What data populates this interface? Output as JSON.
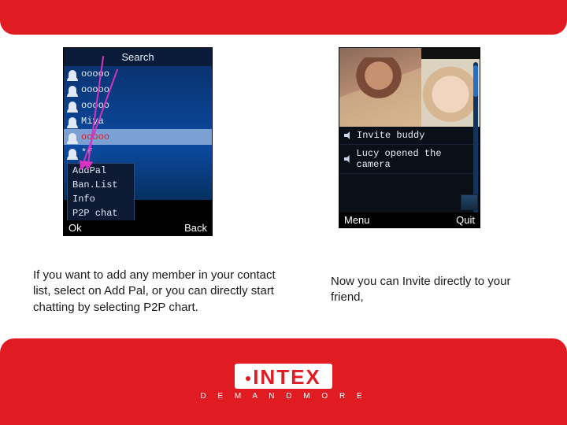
{
  "leftPhone": {
    "title": "Search",
    "contacts": [
      "ooooo",
      "ooooo",
      "ooooo",
      "Miya",
      "ooooo",
      "*f"
    ],
    "selectedIndex": 4,
    "menu": [
      "AddPal",
      "Ban.List",
      "Info",
      "P2P chat"
    ],
    "softkeys": {
      "left": "Ok",
      "right": "Back"
    }
  },
  "rightPhone": {
    "events": [
      "Invite buddy",
      "Lucy opened the camera"
    ],
    "softkeys": {
      "left": "Menu",
      "right": "Quit"
    }
  },
  "captions": {
    "left": "If you want to add any member in your contact list, select on Add Pal, or you can directly start chatting by selecting P2P chart.",
    "right": "Now you can Invite directly to your friend,"
  },
  "brand": {
    "name": "INTEX",
    "tagline": "D E M A N D   M O R E"
  }
}
